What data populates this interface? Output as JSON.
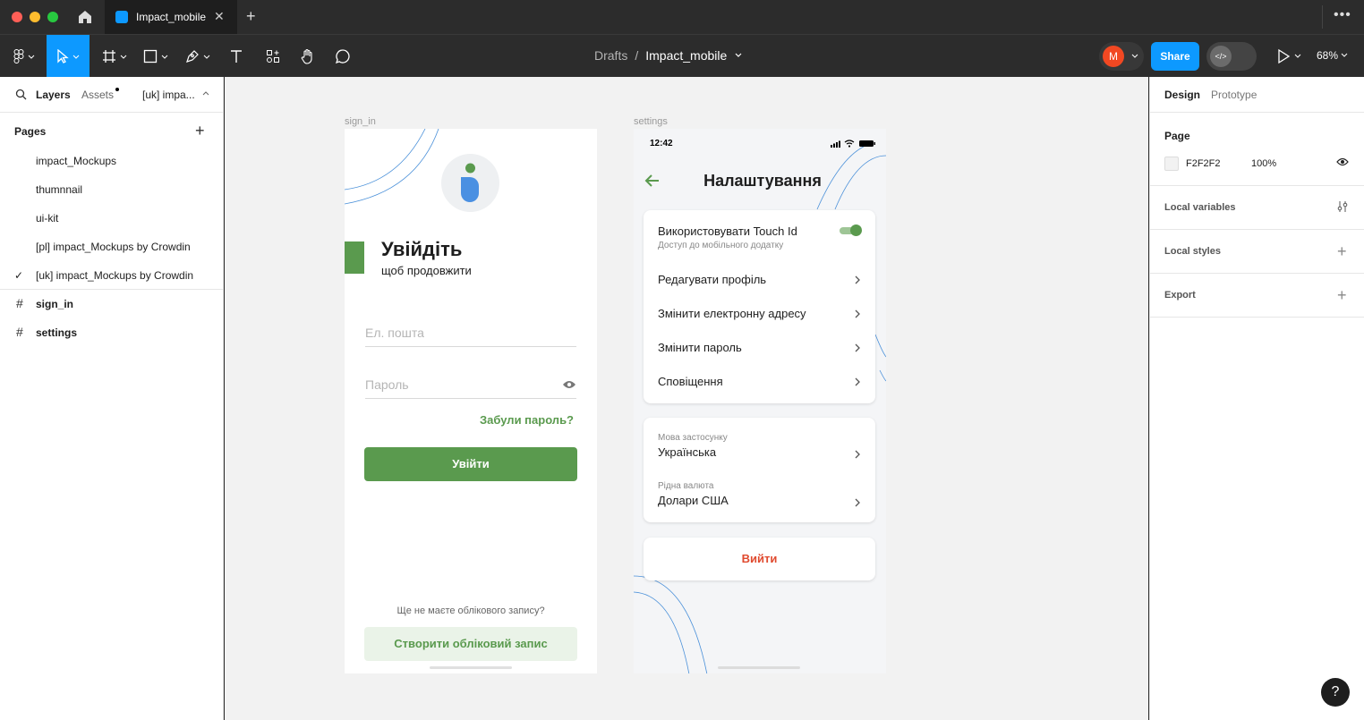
{
  "window": {
    "tab_title": "Impact_mobile",
    "close_glyph": "✕",
    "new_tab_glyph": "+",
    "more_glyph": "•••"
  },
  "toolbar": {
    "breadcrumb_parent": "Drafts",
    "breadcrumb_sep": "/",
    "file_name": "Impact_mobile",
    "avatar_initial": "M",
    "share_label": "Share",
    "zoom": "68%",
    "dev_mode_glyph": "</>"
  },
  "left_panel": {
    "tab_layers": "Layers",
    "tab_assets": "Assets",
    "page_switcher": "[uk] impa...",
    "pages_header": "Pages",
    "pages": [
      {
        "label": "impact_Mockups",
        "current": false
      },
      {
        "label": "thumnnail",
        "current": false
      },
      {
        "label": "ui-kit",
        "current": false
      },
      {
        "label": "[pl] impact_Mockups by Crowdin",
        "current": false
      },
      {
        "label": "[uk] impact_Mockups by Crowdin",
        "current": true
      }
    ],
    "check_glyph": "✓",
    "layers": [
      {
        "label": "sign_in"
      },
      {
        "label": "settings"
      }
    ],
    "frame_glyph": "#"
  },
  "canvas": {
    "sign_in": {
      "frame_label": "sign_in",
      "title": "Увійдіть",
      "subtitle": "щоб продовжити",
      "email_placeholder": "Ел. пошта",
      "password_placeholder": "Пароль",
      "forgot": "Забули пароль?",
      "login_button": "Увійти",
      "no_account": "Ще не маєте облікового запису?",
      "create_button": "Створити обліковий запис"
    },
    "settings": {
      "frame_label": "settings",
      "time": "12:42",
      "title": "Налаштування",
      "touch_id_label": "Використовувати Touch Id",
      "touch_id_sub": "Доступ до мобільного додатку",
      "touch_id_on": true,
      "menu": [
        "Редагувати профіль",
        "Змінити електронну адресу",
        "Змінити пароль",
        "Сповіщення"
      ],
      "language_caption": "Мова застосунку",
      "language_value": "Українська",
      "currency_caption": "Рідна валюта",
      "currency_value": "Долари США",
      "logout": "Вийти"
    },
    "colors": {
      "brand_green": "#5a9a4e",
      "logout_red": "#e04a2f",
      "canvas_bg": "#f2f2f2"
    }
  },
  "right_panel": {
    "tab_design": "Design",
    "tab_prototype": "Prototype",
    "page_header": "Page",
    "page_color": "F2F2F2",
    "page_opacity": "100%",
    "local_variables": "Local variables",
    "local_styles": "Local styles",
    "export": "Export",
    "plus_glyph": "+"
  },
  "help_glyph": "?"
}
